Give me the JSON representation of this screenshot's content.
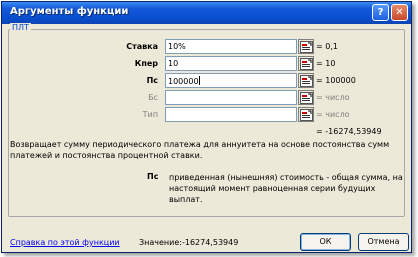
{
  "window": {
    "title": "Аргументы функции"
  },
  "function_group": {
    "name": "ПЛТ"
  },
  "arguments": [
    {
      "label": "Ставка",
      "value": "10%",
      "result": "= 0,1",
      "bold": true
    },
    {
      "label": "Кпер",
      "value": "10",
      "result": "= 10",
      "bold": true
    },
    {
      "label": "Пс",
      "value": "100000",
      "result": "= 100000",
      "bold": true
    },
    {
      "label": "Бс",
      "value": "",
      "result": "= число",
      "bold": false
    },
    {
      "label": "Тип",
      "value": "",
      "result": "= число",
      "bold": false
    }
  ],
  "function_result": "= -16274,53949",
  "description": "Возвращает сумму периодического платежа для аннуитета на основе постоянства сумм платежей и постоянства процентной ставки.",
  "argument_help": {
    "name": "Пс",
    "text": "приведенная (нынешняя) стоимость - общая сумма, на настоящий момент равноценная серии будущих выплат."
  },
  "footer": {
    "help_link": "Справка по этой функции",
    "value_label": "Значение:",
    "value": "-16274,53949",
    "ok_label": "ОК",
    "cancel_label": "Отмена"
  },
  "icons": {
    "ref": "collapse-dialog-icon",
    "help": "help-icon",
    "close": "close-icon"
  },
  "colors": {
    "title_bar": "#0a4fd0",
    "group_label": "#0046d5",
    "link": "#0000ee"
  }
}
